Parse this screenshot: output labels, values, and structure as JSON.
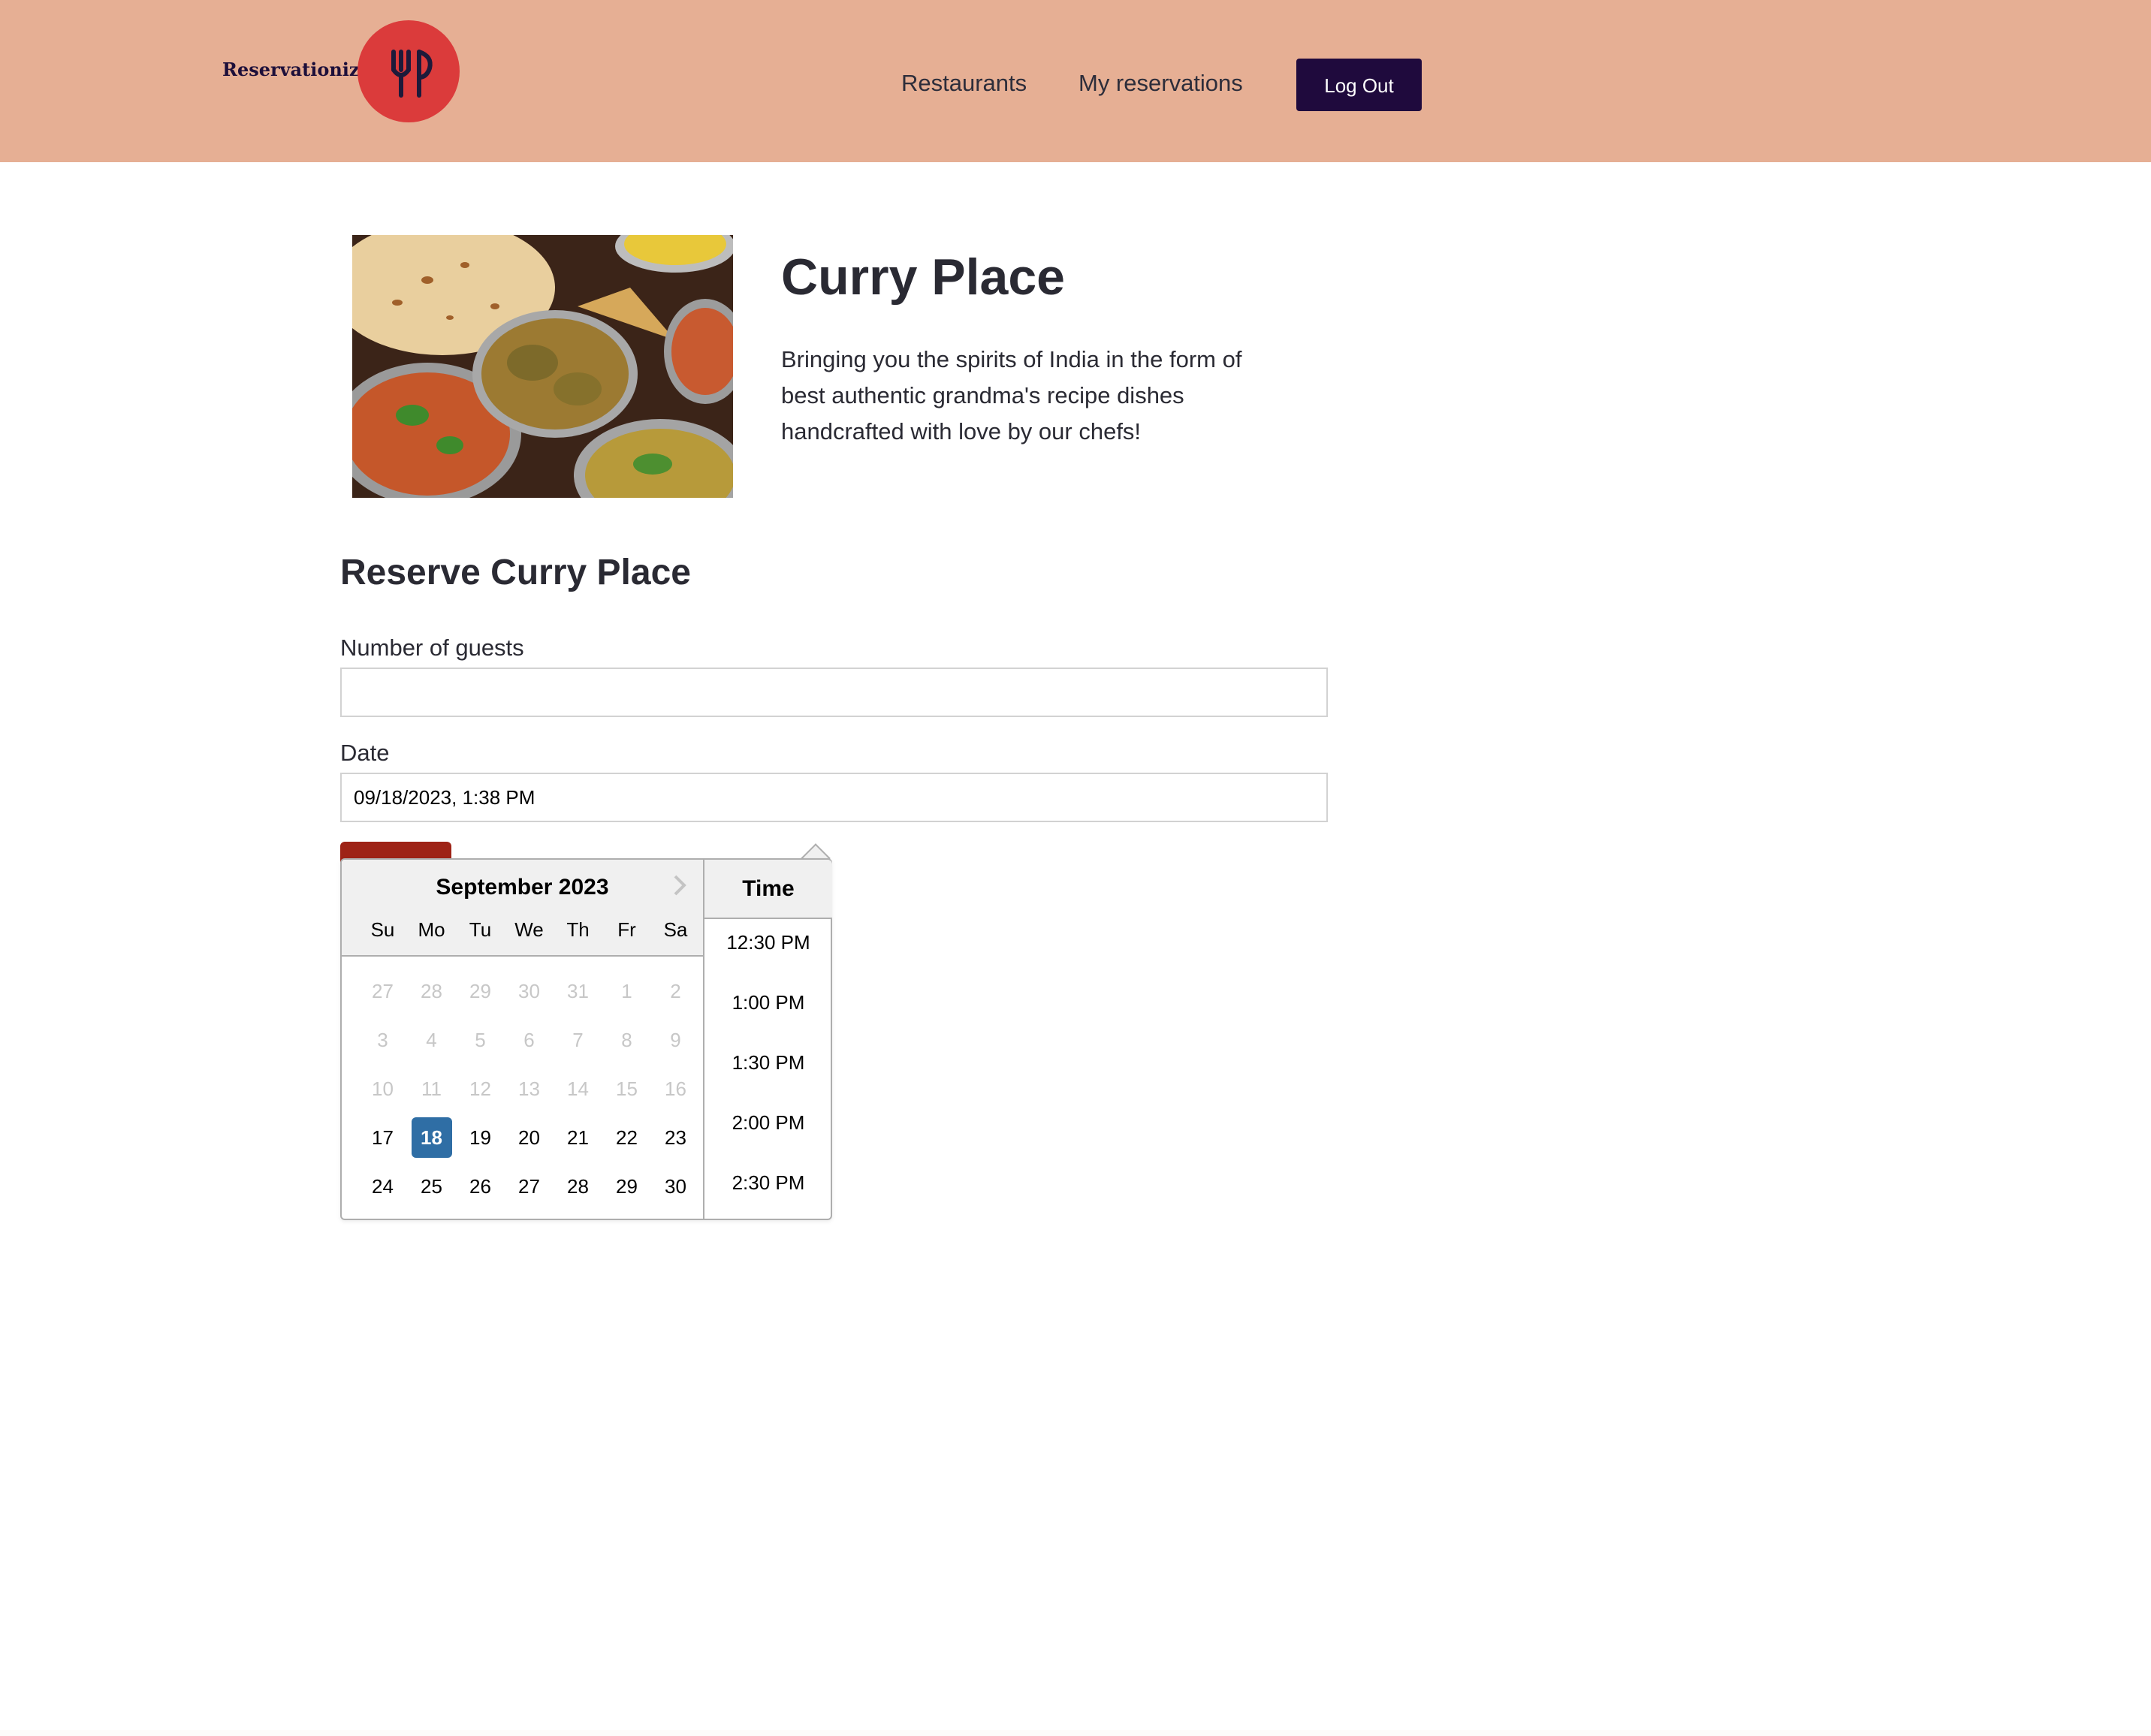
{
  "header": {
    "brand": "Reservationizr",
    "nav": {
      "restaurants": "Restaurants",
      "my_reservations": "My reservations"
    },
    "logout_label": "Log Out",
    "colors": {
      "header_bg": "#e6af94",
      "logo_bg": "#db3b3b",
      "button_bg": "#1f0a3d"
    }
  },
  "restaurant": {
    "name": "Curry Place",
    "description": "Bringing you the spirits of India in the form of best authentic grandma's recipe dishes handcrafted with love by our chefs!"
  },
  "form": {
    "title": "Reserve Curry Place",
    "guests_label": "Number of guests",
    "guests_value": "",
    "date_label": "Date",
    "date_value": "09/18/2023, 1:38 PM",
    "submit_color": "#9e2316"
  },
  "datepicker": {
    "month_label": "September 2023",
    "next_icon": "chevron-right-icon",
    "weekdays": [
      "Su",
      "Mo",
      "Tu",
      "We",
      "Th",
      "Fr",
      "Sa"
    ],
    "weeks": [
      [
        "27",
        "28",
        "29",
        "30",
        "31",
        "1",
        "2"
      ],
      [
        "3",
        "4",
        "5",
        "6",
        "7",
        "8",
        "9"
      ],
      [
        "10",
        "11",
        "12",
        "13",
        "14",
        "15",
        "16"
      ],
      [
        "17",
        "18",
        "19",
        "20",
        "21",
        "22",
        "23"
      ],
      [
        "24",
        "25",
        "26",
        "27",
        "28",
        "29",
        "30"
      ]
    ],
    "muted_count": 21,
    "selected_day": "18",
    "selected_color": "#2f6ea5",
    "time_header": "Time",
    "times": [
      "12:30 PM",
      "1:00 PM",
      "1:30 PM",
      "2:00 PM",
      "2:30 PM"
    ]
  }
}
